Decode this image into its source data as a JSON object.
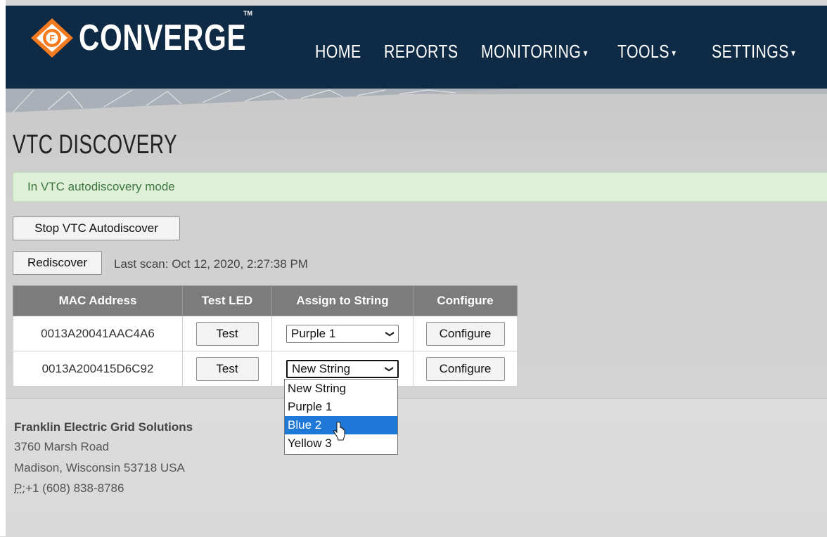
{
  "brand": {
    "name": "CONVERGE",
    "tm": "TM",
    "accent": "#f47b20",
    "navbar_bg": "#0e2a44"
  },
  "nav": {
    "home": "HOME",
    "reports": "REPORTS",
    "monitoring": "MONITORING",
    "tools": "TOOLS",
    "settings": "SETTINGS"
  },
  "page": {
    "title": "VTC DISCOVERY"
  },
  "alert": {
    "text": "In VTC autodiscovery mode",
    "color": "#dff0d8"
  },
  "actions": {
    "stop_label": "Stop VTC Autodiscover",
    "rediscover_label": "Rediscover",
    "last_scan": "Last scan: Oct 12, 2020, 2:27:38 PM"
  },
  "table": {
    "headers": [
      "MAC Address",
      "Test LED",
      "Assign to String",
      "Configure"
    ],
    "rows": [
      {
        "mac": "0013A20041AAC4A6",
        "test_label": "Test",
        "assigned": "Purple 1",
        "configure_label": "Configure"
      },
      {
        "mac": "0013A200415D6C92",
        "test_label": "Test",
        "assigned": "New String",
        "configure_label": "Configure"
      }
    ]
  },
  "dropdown": {
    "options": [
      "New String",
      "Purple 1",
      "Blue 2",
      "Yellow 3"
    ],
    "highlighted": "Blue 2",
    "highlight_color": "#1e78d7"
  },
  "footer": {
    "company": "Franklin Electric Grid Solutions",
    "address1": "3760 Marsh Road",
    "address2": "Madison, Wisconsin 53718 USA",
    "phone_label": "P:",
    "phone": "+1 (608) 838-8786"
  }
}
